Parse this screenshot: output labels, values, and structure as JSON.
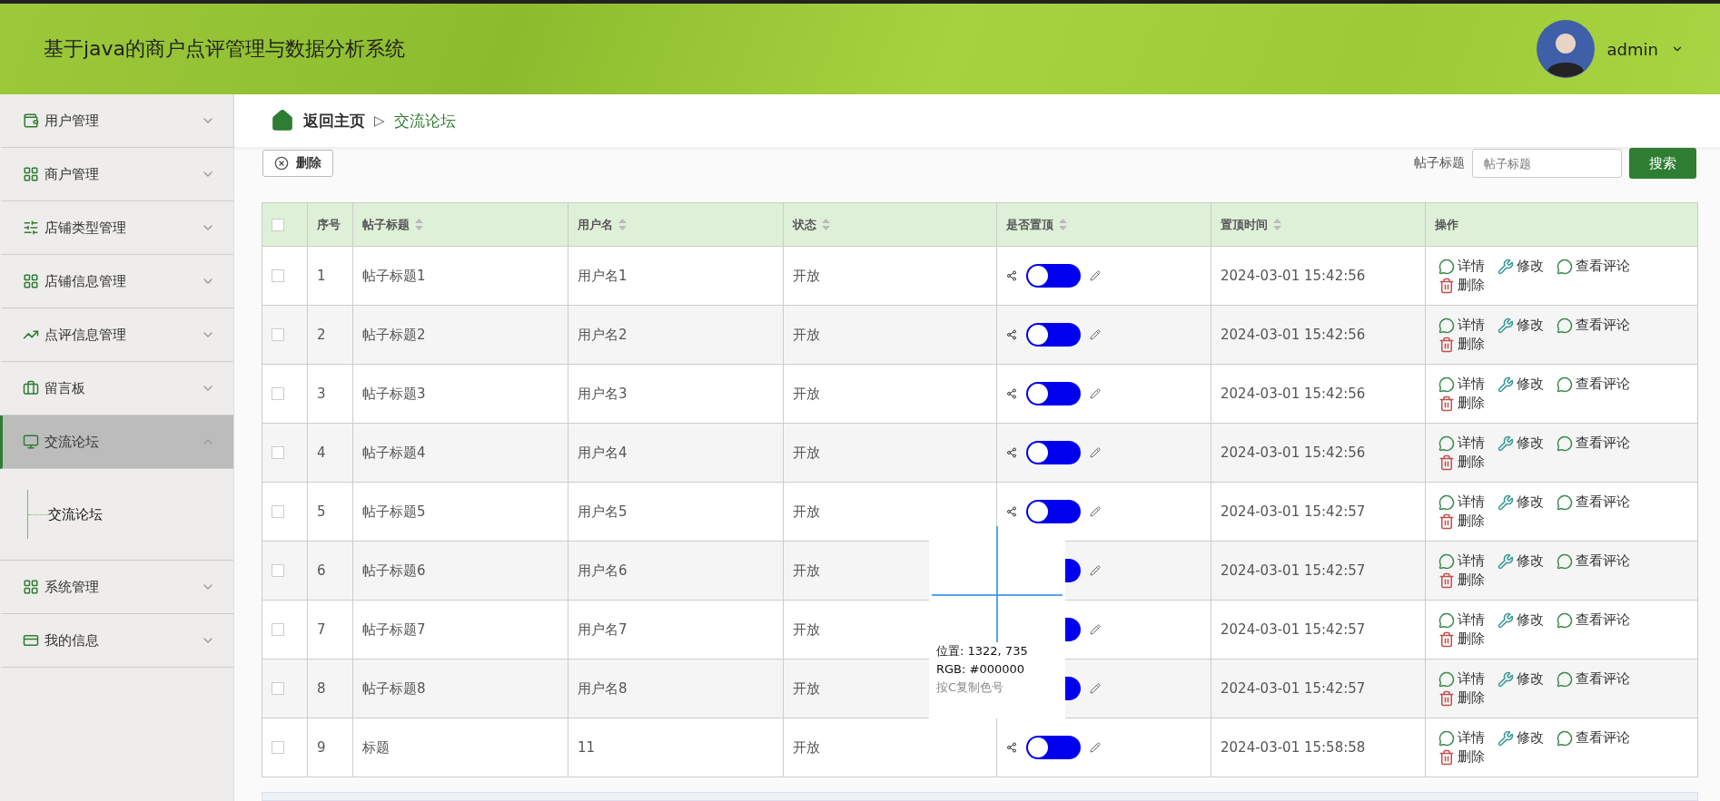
{
  "header": {
    "title": "基于java的商户点评管理与数据分析系统",
    "user": "admin"
  },
  "sidebar": {
    "items": [
      {
        "label": "用户管理",
        "selected": false,
        "expanded": false
      },
      {
        "label": "商户管理",
        "selected": false,
        "expanded": false
      },
      {
        "label": "店铺类型管理",
        "selected": false,
        "expanded": false
      },
      {
        "label": "店铺信息管理",
        "selected": false,
        "expanded": false
      },
      {
        "label": "点评信息管理",
        "selected": false,
        "expanded": false
      },
      {
        "label": "留言板",
        "selected": false,
        "expanded": false
      },
      {
        "label": "交流论坛",
        "selected": true,
        "expanded": true,
        "children": [
          {
            "label": "交流论坛"
          }
        ]
      },
      {
        "label": "系统管理",
        "selected": false,
        "expanded": false
      },
      {
        "label": "我的信息",
        "selected": false,
        "expanded": false
      }
    ]
  },
  "breadcrumb": {
    "home": "返回主页",
    "separator": "▷",
    "current": "交流论坛"
  },
  "toolbar": {
    "delete_button": "删除",
    "search_label": "帖子标题",
    "search": {
      "placeholder": "帖子标题"
    },
    "search_button": "搜索"
  },
  "table": {
    "header_checked": false,
    "columns": [
      {
        "label": "序号",
        "sortable": false
      },
      {
        "label": "帖子标题",
        "sortable": true
      },
      {
        "label": "用户名",
        "sortable": true
      },
      {
        "label": "状态",
        "sortable": true
      },
      {
        "label": "是否置顶",
        "sortable": true
      },
      {
        "label": "置顶时间",
        "sortable": true
      },
      {
        "label": "操作",
        "sortable": false
      }
    ],
    "rows": [
      {
        "checked": false,
        "no": "1",
        "title": "帖子标题1",
        "user": "用户名1",
        "status": "开放",
        "pinned": false,
        "time": "2024-03-01 15:42:56",
        "actions": [
          "详情",
          "修改",
          "查看评论",
          "删除"
        ]
      },
      {
        "checked": false,
        "no": "2",
        "title": "帖子标题2",
        "user": "用户名2",
        "status": "开放",
        "pinned": false,
        "time": "2024-03-01 15:42:56",
        "actions": [
          "详情",
          "修改",
          "查看评论",
          "删除"
        ]
      },
      {
        "checked": false,
        "no": "3",
        "title": "帖子标题3",
        "user": "用户名3",
        "status": "开放",
        "pinned": false,
        "time": "2024-03-01 15:42:56",
        "actions": [
          "详情",
          "修改",
          "查看评论",
          "删除"
        ]
      },
      {
        "checked": false,
        "no": "4",
        "title": "帖子标题4",
        "user": "用户名4",
        "status": "开放",
        "pinned": false,
        "time": "2024-03-01 15:42:56",
        "actions": [
          "详情",
          "修改",
          "查看评论",
          "删除"
        ]
      },
      {
        "checked": false,
        "no": "5",
        "title": "帖子标题5",
        "user": "用户名5",
        "status": "开放",
        "pinned": false,
        "time": "2024-03-01 15:42:57",
        "actions": [
          "详情",
          "修改",
          "查看评论",
          "删除"
        ]
      },
      {
        "checked": false,
        "no": "6",
        "title": "帖子标题6",
        "user": "用户名6",
        "status": "开放",
        "pinned": false,
        "time": "2024-03-01 15:42:57",
        "actions": [
          "详情",
          "修改",
          "查看评论",
          "删除"
        ]
      },
      {
        "checked": false,
        "no": "7",
        "title": "帖子标题7",
        "user": "用户名7",
        "status": "开放",
        "pinned": false,
        "time": "2024-03-01 15:42:57",
        "actions": [
          "详情",
          "修改",
          "查看评论",
          "删除"
        ]
      },
      {
        "checked": false,
        "no": "8",
        "title": "帖子标题8",
        "user": "用户名8",
        "status": "开放",
        "pinned": false,
        "time": "2024-03-01 15:42:57",
        "actions": [
          "详情",
          "修改",
          "查看评论",
          "删除"
        ]
      },
      {
        "checked": false,
        "no": "9",
        "title": "标题",
        "user": "11",
        "status": "开放",
        "pinned": false,
        "time": "2024-03-01 15:58:58",
        "actions": [
          "详情",
          "修改",
          "查看评论",
          "删除"
        ]
      }
    ]
  },
  "color_picker": {
    "position": "位置: 1322, 735",
    "rgb": "RGB: #000000",
    "hint": "按C复制色号"
  }
}
